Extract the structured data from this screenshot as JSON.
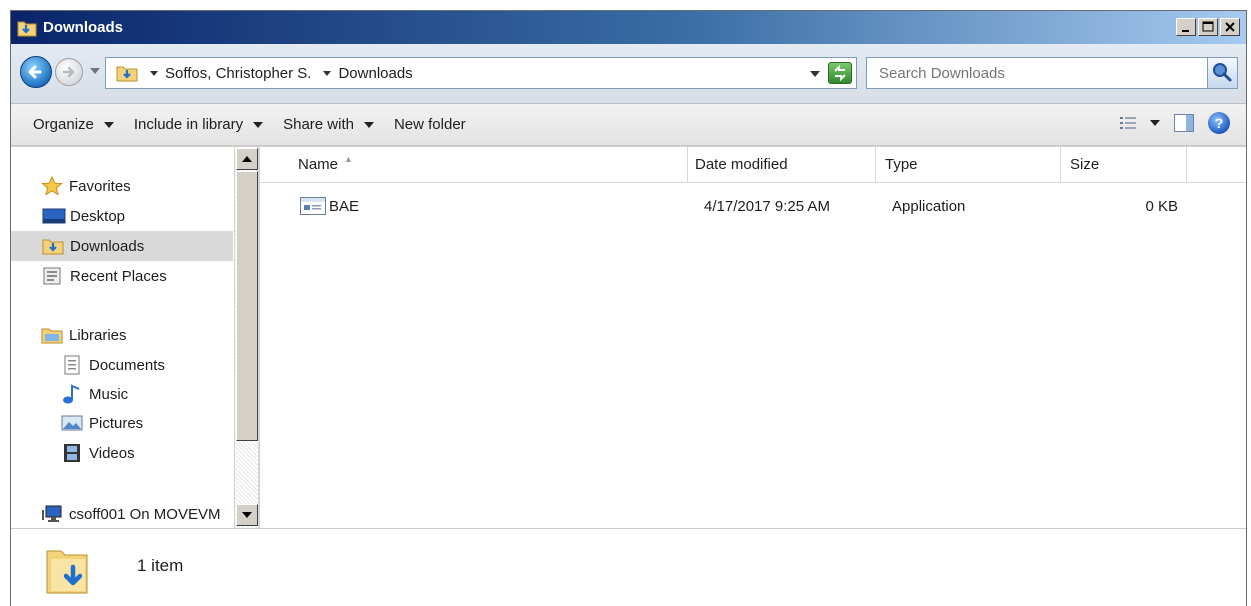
{
  "window": {
    "title": "Downloads",
    "colors": {
      "title_start": "#0a246a",
      "title_end": "#a6caf0",
      "selection": "#d9d9d9"
    }
  },
  "address": {
    "breadcrumbs": [
      "Soffos, Christopher S.",
      "Downloads"
    ],
    "search_placeholder": "Search Downloads"
  },
  "toolbar": {
    "items": [
      "Organize",
      "Include in library",
      "Share with",
      "New folder"
    ]
  },
  "nav": {
    "favorites_label": "Favorites",
    "favorites": [
      "Desktop",
      "Downloads",
      "Recent Places"
    ],
    "selected": "Downloads",
    "libraries_label": "Libraries",
    "libraries": [
      "Documents",
      "Music",
      "Pictures",
      "Videos"
    ],
    "computer_label": "csoff001 On MOVEVM"
  },
  "columns": [
    "Name",
    "Date modified",
    "Type",
    "Size"
  ],
  "files": [
    {
      "name": "BAE",
      "date_modified": "4/17/2017 9:25 AM",
      "type": "Application",
      "size": "0 KB",
      "icon": "application-icon"
    }
  ],
  "status": {
    "item_count": "1 item"
  }
}
